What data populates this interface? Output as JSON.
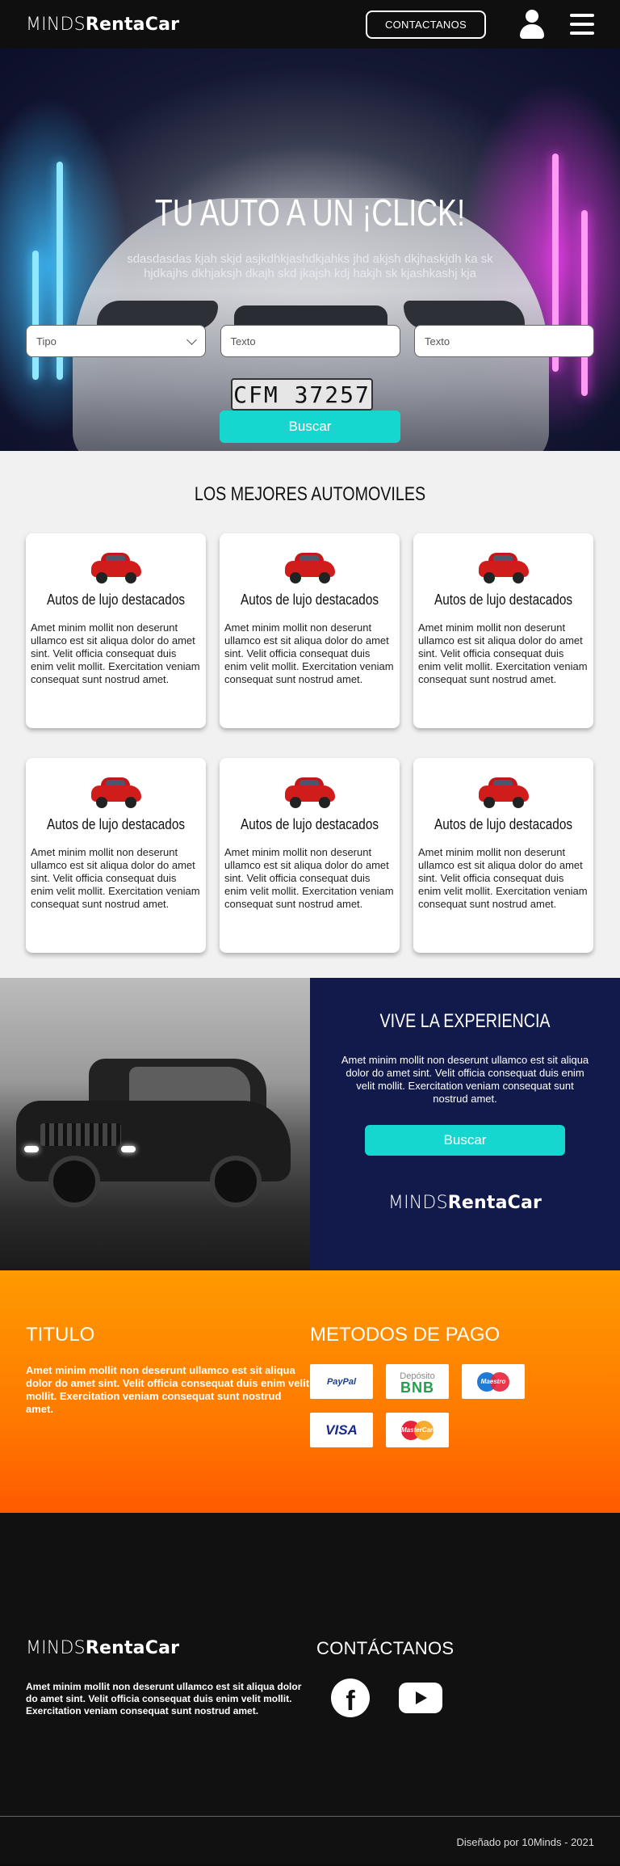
{
  "header": {
    "logo_light": "MINDS",
    "logo_bold": "RentaCar",
    "contact_label": "CONTACTANOS"
  },
  "hero": {
    "title": "TU AUTO A UN ¡CLICK!",
    "subtitle": "sdasdasdas kjah skjd asjkdhkjashdkjahks jhd akjsh dkjhaskjdh ka sk hjdkajhs dkhjaksjh dkajh skd jkajsh kdj hakjh sk  kjashkashj kja",
    "plate": "CFM 37257",
    "select_value": "Tipo",
    "input1_placeholder": "Texto",
    "input2_placeholder": "Texto",
    "search_label": "Buscar"
  },
  "best": {
    "title": "LOS MEJORES AUTOMOVILES",
    "cards": [
      {
        "title": "Autos de lujo destacados",
        "text": "Amet minim mollit non deserunt ullamco est sit aliqua dolor do amet sint. Velit officia consequat duis enim velit mollit. Exercitation veniam consequat sunt nostrud amet."
      },
      {
        "title": "Autos de lujo destacados",
        "text": "Amet minim mollit non deserunt ullamco est sit aliqua dolor do amet sint. Velit officia consequat duis enim velit mollit. Exercitation veniam consequat sunt nostrud amet."
      },
      {
        "title": "Autos de lujo destacados",
        "text": "Amet minim mollit non deserunt ullamco est sit aliqua dolor do amet sint. Velit officia consequat duis enim velit mollit. Exercitation veniam consequat sunt nostrud amet."
      },
      {
        "title": "Autos de lujo destacados",
        "text": "Amet minim mollit non deserunt ullamco est sit aliqua dolor do amet sint. Velit officia consequat duis enim velit mollit. Exercitation veniam consequat sunt nostrud amet."
      },
      {
        "title": "Autos de lujo destacados",
        "text": "Amet minim mollit non deserunt ullamco est sit aliqua dolor do amet sint. Velit officia consequat duis enim velit mollit. Exercitation veniam consequat sunt nostrud amet."
      },
      {
        "title": "Autos de lujo destacados",
        "text": "Amet minim mollit non deserunt ullamco est sit aliqua dolor do amet sint. Velit officia consequat duis enim velit mollit. Exercitation veniam consequat sunt nostrud amet."
      }
    ]
  },
  "experience": {
    "title": "VIVE LA EXPERIENCIA",
    "text": "Amet minim mollit non deserunt ullamco est sit aliqua dolor do amet sint. Velit officia consequat duis enim velit mollit. Exercitation veniam consequat sunt nostrud amet.",
    "button_label": "Buscar",
    "logo_light": "MINDS",
    "logo_bold": "RentaCar"
  },
  "info": {
    "title": "TITULO",
    "text": "Amet minim mollit non deserunt ullamco est sit aliqua dolor do amet sint. Velit officia consequat duis enim velit mollit. Exercitation veniam consequat sunt nostrud amet.",
    "payments_title": "METODOS DE PAGO",
    "payments": {
      "paypal": "PayPal",
      "bnb_top": "Depósito",
      "bnb_main": "BNB",
      "maestro": "Maestro",
      "visa": "VISA",
      "mastercard": "MasterCard"
    }
  },
  "footer": {
    "logo_light": "MINDS",
    "logo_bold": "RentaCar",
    "text": "Amet minim mollit non deserunt ullamco est sit aliqua dolor do amet sint. Velit officia consequat duis enim velit mollit. Exercitation veniam consequat sunt nostrud amet.",
    "contact_title": "CONTÁCTANOS",
    "facebook_glyph": "f",
    "credit": "Diseñado por 10Minds - 2021"
  },
  "colors": {
    "accent": "#16d6d0",
    "navy": "#111a4a",
    "orange": "#ff7a00",
    "dark": "#111111"
  }
}
